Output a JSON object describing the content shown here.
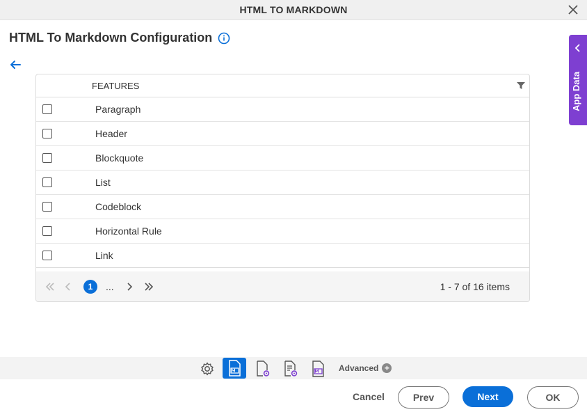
{
  "window": {
    "title": "HTML TO MARKDOWN"
  },
  "page": {
    "title": "HTML To Markdown Configuration"
  },
  "grid": {
    "column_header": "FEATURES",
    "rows": [
      {
        "label": "Paragraph",
        "checked": false
      },
      {
        "label": "Header",
        "checked": false
      },
      {
        "label": "Blockquote",
        "checked": false
      },
      {
        "label": "List",
        "checked": false
      },
      {
        "label": "Codeblock",
        "checked": false
      },
      {
        "label": "Horizontal Rule",
        "checked": false
      },
      {
        "label": "Link",
        "checked": false
      }
    ],
    "pager": {
      "current_page": "1",
      "ellipsis": "...",
      "info": "1 - 7 of 16 items"
    }
  },
  "side_panel": {
    "label": "App Data"
  },
  "toolbar": {
    "icons": [
      "gear-icon",
      "markdown-file-icon",
      "file-settings-icon",
      "document-settings-icon",
      "markdown-output-icon"
    ],
    "advanced_label": "Advanced"
  },
  "footer": {
    "cancel": "Cancel",
    "prev": "Prev",
    "next": "Next",
    "ok": "OK"
  },
  "colors": {
    "accent": "#0a6fd8",
    "side_panel": "#7e3fd1"
  }
}
